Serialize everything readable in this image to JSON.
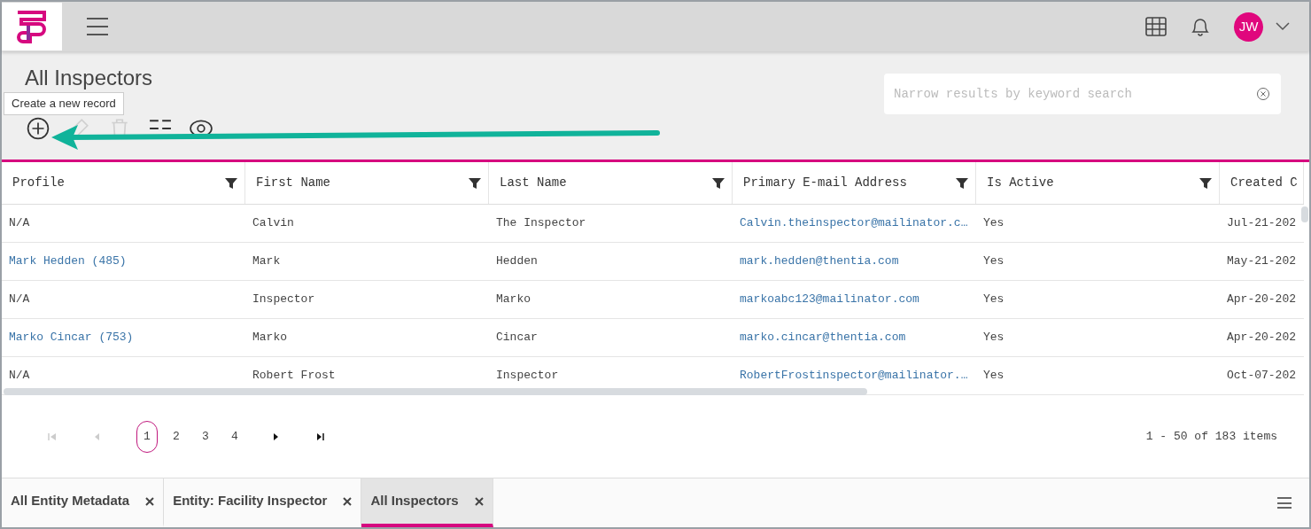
{
  "header": {
    "avatar_initials": "JW"
  },
  "page": {
    "title": "All Inspectors",
    "tooltip": "Create a new record",
    "search": {
      "placeholder": "Narrow results by keyword search"
    }
  },
  "toolbar": [
    {
      "kind": "add",
      "disabled": false
    },
    {
      "kind": "edit",
      "disabled": true
    },
    {
      "kind": "delete",
      "disabled": true
    },
    {
      "kind": "columns",
      "disabled": false
    },
    {
      "kind": "view",
      "disabled": false
    }
  ],
  "table": {
    "columns": [
      {
        "label": "Profile",
        "filter": true
      },
      {
        "label": "First Name",
        "filter": true
      },
      {
        "label": "Last Name",
        "filter": true
      },
      {
        "label": "Primary E-mail Address",
        "filter": true
      },
      {
        "label": "Is Active",
        "filter": true
      },
      {
        "label": "Created C",
        "filter": false
      }
    ],
    "rows": [
      {
        "cells": [
          "N/A",
          "Calvin",
          "The Inspector",
          "Calvin.theinspector@mailinator.c…",
          "Yes",
          "Jul-21-202"
        ],
        "links": [
          false,
          false,
          false,
          true,
          false,
          false
        ]
      },
      {
        "cells": [
          "Mark Hedden (485)",
          "Mark",
          "Hedden",
          "mark.hedden@thentia.com",
          "Yes",
          "May-21-202"
        ],
        "links": [
          true,
          false,
          false,
          true,
          false,
          false
        ]
      },
      {
        "cells": [
          "N/A",
          "Inspector",
          "Marko",
          "markoabc123@mailinator.com",
          "Yes",
          "Apr-20-202"
        ],
        "links": [
          false,
          false,
          false,
          true,
          false,
          false
        ]
      },
      {
        "cells": [
          "Marko Cincar (753)",
          "Marko",
          "Cincar",
          "marko.cincar@thentia.com",
          "Yes",
          "Apr-20-202"
        ],
        "links": [
          true,
          false,
          false,
          true,
          false,
          false
        ]
      },
      {
        "cells": [
          "N/A",
          "Robert Frost",
          "Inspector",
          "RobertFrostinspector@mailinator.…",
          "Yes",
          "Oct-07-202"
        ],
        "links": [
          false,
          false,
          false,
          true,
          false,
          false
        ]
      }
    ]
  },
  "pager": {
    "first_disabled": true,
    "prev_disabled": true,
    "pages": [
      {
        "label": "1",
        "selected": true
      },
      {
        "label": "2",
        "selected": false
      },
      {
        "label": "3",
        "selected": false
      },
      {
        "label": "4",
        "selected": false
      }
    ],
    "summary": "1 - 50 of 183 items"
  },
  "tabs": [
    {
      "label": "All Entity Metadata",
      "selected": false
    },
    {
      "label": "Entity: Facility Inspector",
      "selected": false
    },
    {
      "label": "All Inspectors",
      "selected": true
    }
  ]
}
